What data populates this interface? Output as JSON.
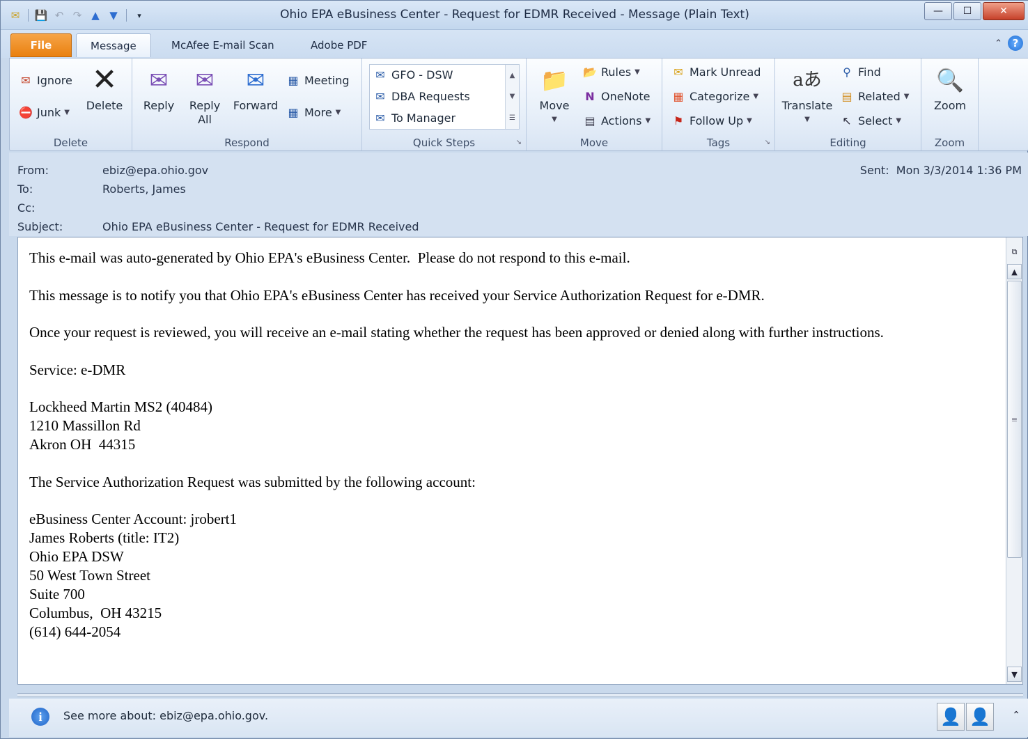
{
  "window": {
    "title": "Ohio EPA eBusiness Center - Request for EDMR Received  -  Message (Plain Text)",
    "controls": {
      "minimize": "—",
      "maximize": "☐",
      "close": "✕"
    }
  },
  "qat": {
    "icons": [
      "mail-icon",
      "save-icon",
      "undo-icon",
      "redo-icon",
      "up-icon",
      "down-icon",
      "customize-icon"
    ]
  },
  "tabs": {
    "file": "File",
    "message": "Message",
    "mcafee": "McAfee E-mail Scan",
    "adobe": "Adobe PDF"
  },
  "ribbon": {
    "delete_group": {
      "ignore": "Ignore",
      "junk": "Junk",
      "delete": "Delete",
      "label": "Delete"
    },
    "respond_group": {
      "reply": "Reply",
      "reply_all_1": "Reply",
      "reply_all_2": "All",
      "forward": "Forward",
      "meeting": "Meeting",
      "more": "More",
      "label": "Respond"
    },
    "quicksteps_group": {
      "items": [
        "GFO - DSW",
        "DBA Requests",
        "To Manager"
      ],
      "label": "Quick Steps"
    },
    "move_group": {
      "move": "Move",
      "rules": "Rules",
      "onenote": "OneNote",
      "actions": "Actions",
      "label": "Move"
    },
    "tags_group": {
      "mark_unread": "Mark Unread",
      "categorize": "Categorize",
      "follow_up": "Follow Up",
      "label": "Tags"
    },
    "editing_group": {
      "translate": "Translate",
      "find": "Find",
      "related": "Related",
      "select": "Select",
      "label": "Editing"
    },
    "zoom_group": {
      "zoom": "Zoom",
      "label": "Zoom"
    }
  },
  "header": {
    "from_label": "From:",
    "from": "ebiz@epa.ohio.gov",
    "to_label": "To:",
    "to": "Roberts, James",
    "cc_label": "Cc:",
    "cc": "",
    "subject_label": "Subject:",
    "subject": "Ohio EPA eBusiness Center - Request for EDMR Received",
    "sent_label": "Sent:",
    "sent": "Mon 3/3/2014 1:36 PM"
  },
  "body": {
    "p1": "This e-mail was auto-generated by Ohio EPA's eBusiness Center.  Please do not respond to this e-mail.",
    "p2": "This message is to notify you that Ohio EPA's eBusiness Center has received your Service Authorization Request for e-DMR.",
    "p3": "Once your request is reviewed, you will receive an e-mail stating whether the request has been approved or denied along with further instructions.",
    "p4": "Service: e-DMR",
    "p5": "Lockheed Martin MS2 (40484)\n1210 Massillon Rd\nAkron OH  44315",
    "p6": "The Service Authorization Request was submitted by the following account:",
    "p7": "eBusiness Center Account: jrobert1\nJames Roberts (title: IT2)\nOhio EPA DSW\n50 West Town Street\nSuite 700\nColumbus,  OH 43215\n(614) 644-2054"
  },
  "people_pane": {
    "text": "See more about: ebiz@epa.ohio.gov."
  }
}
